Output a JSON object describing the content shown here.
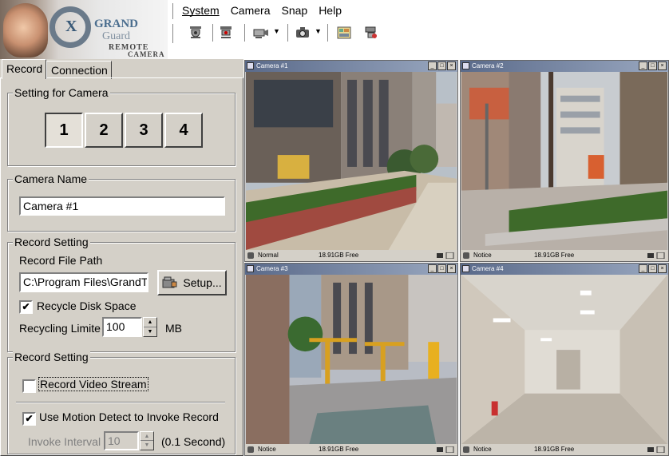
{
  "app": {
    "logo": {
      "line1": "GRAND",
      "line2": "Guard",
      "line3": "REMOTE",
      "line4": "CAMERA",
      "mark": "X"
    }
  },
  "menu": [
    "System",
    "Camera",
    "Snap",
    "Help"
  ],
  "toolbar": {
    "icons": [
      "camera-dome-icon",
      "camera-dome-alt-icon",
      "camera-record-icon",
      "snapshot-icon",
      "settings-panel-icon",
      "camera-config-icon"
    ]
  },
  "tabs": [
    {
      "label": "Record",
      "active": true
    },
    {
      "label": "Connection",
      "active": false
    }
  ],
  "setting_for_camera": {
    "title": "Setting for Camera",
    "buttons": [
      "1",
      "2",
      "3",
      "4"
    ],
    "selected": "1"
  },
  "camera_name": {
    "title": "Camera Name",
    "value": "Camera #1"
  },
  "record_setting": {
    "title": "Record Setting",
    "file_path_label": "Record File Path",
    "file_path_value": "C:\\Program Files\\GrandTe",
    "setup_label": "Setup...",
    "recycle_label": "Recycle Disk Space",
    "recycle_checked": true,
    "limit_label": "Recycling Limite",
    "limit_value": "100",
    "limit_unit": "MB"
  },
  "record_setting2": {
    "title": "Record Setting",
    "video_stream_label": "Record Video Stream",
    "video_stream_checked": false,
    "motion_label": "Use Motion Detect to Invoke Record",
    "motion_checked": true,
    "interval_label": "Invoke Interval",
    "interval_value": "10",
    "interval_unit": "(0.1 Second)"
  },
  "cameras": [
    {
      "title": "Camera #1",
      "status": "Normal",
      "free": "18.91GB Free"
    },
    {
      "title": "Camera #2",
      "status": "Notice",
      "free": "18.91GB Free"
    },
    {
      "title": "Camera #3",
      "status": "Notice",
      "free": "18.91GB Free"
    },
    {
      "title": "Camera #4",
      "status": "Notice",
      "free": "18.91GB Free"
    }
  ],
  "check_mark": "✔"
}
